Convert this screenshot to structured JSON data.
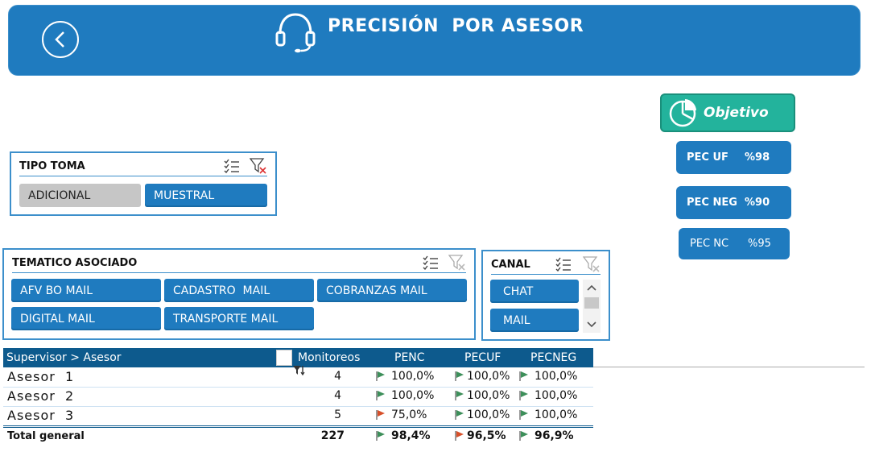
{
  "header": {
    "title": "PRECISIÓN  POR ASESOR",
    "color": "#1f7bbf"
  },
  "objective": {
    "label": "Objetivo",
    "items": [
      {
        "name": "PEC UF",
        "value": "%98"
      },
      {
        "name": "PEC NEG",
        "value": "%90"
      },
      {
        "name": "PEC NC",
        "value": "%95"
      }
    ]
  },
  "slicers": {
    "tipo_toma": {
      "title": "TIPO TOMA",
      "options": [
        {
          "label": "ADICIONAL",
          "selected": false
        },
        {
          "label": "MUESTRAL",
          "selected": true
        }
      ]
    },
    "tematico": {
      "title": "TEMATICO ASOCIADO",
      "options": [
        {
          "label": "AFV BO MAIL"
        },
        {
          "label": "CADASTRO  MAIL"
        },
        {
          "label": "COBRANZAS MAIL"
        },
        {
          "label": "DIGITAL MAIL"
        },
        {
          "label": "TRANSPORTE MAIL"
        }
      ]
    },
    "canal": {
      "title": "CANAL",
      "options": [
        {
          "label": "CHAT"
        },
        {
          "label": "MAIL"
        }
      ]
    }
  },
  "pivot": {
    "headers": {
      "row_label": "Supervisor > Asesor",
      "monitoreos": "Monitoreos",
      "penc": "PENC",
      "pecuf": "PECUF",
      "pecneg": "PECNEG"
    },
    "rows": [
      {
        "name": "Asesor  1",
        "monitoreos": "4",
        "penc": "100,0%",
        "pecuf": "100,0%",
        "pecneg": "100,0%",
        "penc_flag": "green",
        "pecuf_flag": "green",
        "pecneg_flag": "green"
      },
      {
        "name": "Asesor  2",
        "monitoreos": "4",
        "penc": "100,0%",
        "pecuf": "100,0%",
        "pecneg": "100,0%",
        "penc_flag": "green",
        "pecuf_flag": "green",
        "pecneg_flag": "green"
      },
      {
        "name": "Asesor  3",
        "monitoreos": "5",
        "penc": "75,0%",
        "pecuf": "100,0%",
        "pecneg": "100,0%",
        "penc_flag": "red",
        "pecuf_flag": "green",
        "pecneg_flag": "green"
      }
    ],
    "total": {
      "name": "Total general",
      "monitoreos": "227",
      "penc": "98,4%",
      "pecuf": "96,5%",
      "pecneg": "96,9%",
      "penc_flag": "green",
      "pecuf_flag": "red",
      "pecneg_flag": "green"
    },
    "flag_colors": {
      "green": "#3d8f5a",
      "red": "#d7502a"
    }
  }
}
